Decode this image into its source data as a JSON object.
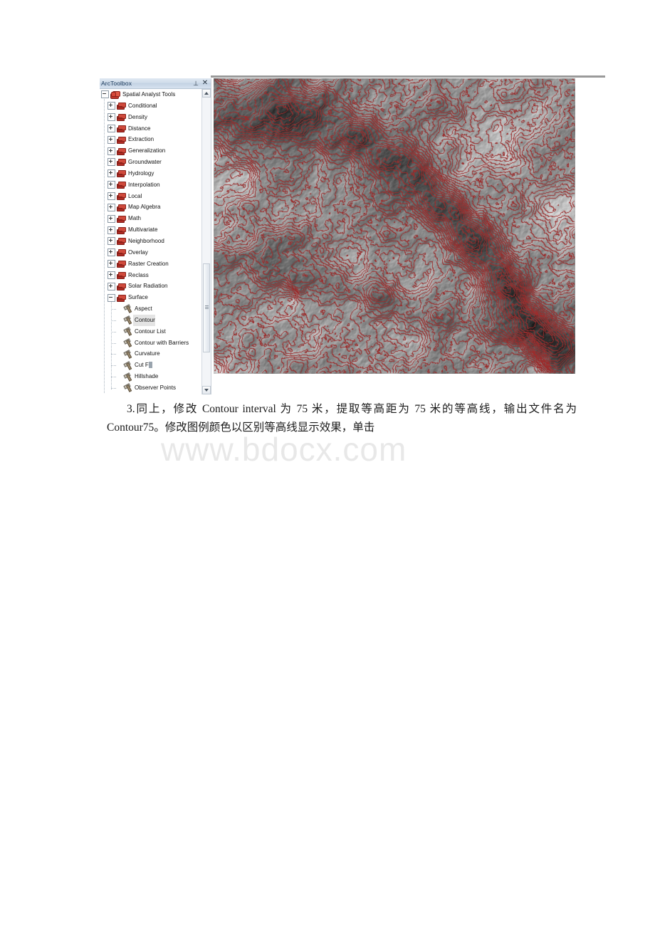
{
  "document": {
    "paragraph_prefix": "3.",
    "paragraph_text": "同上，修改 Contour interval 为 75 米，提取等高距为 75 米的等高线，输出文件名为 Contour75。修改图例颜色以区别等高线显示效果，单击",
    "watermark": "www.bdocx.com"
  },
  "arctoolbox": {
    "title": "ArcToolbox",
    "pin_icon": "pushpin-icon",
    "pin_glyph": "⊥",
    "close_icon": "close-icon",
    "close_glyph": "✕",
    "scrollbar": {
      "up_arrow": "scroll-up-arrow",
      "down_arrow": "scroll-down-arrow",
      "thumb": "scroll-thumb"
    },
    "tree": [
      {
        "label": "Spatial Analyst Tools",
        "level": 0,
        "icon": "toolbox-icon",
        "state": "expanded",
        "selected": false
      },
      {
        "label": "Conditional",
        "level": 1,
        "icon": "toolbox-icon",
        "state": "collapsed",
        "selected": false
      },
      {
        "label": "Density",
        "level": 1,
        "icon": "toolbox-icon",
        "state": "collapsed",
        "selected": false
      },
      {
        "label": "Distance",
        "level": 1,
        "icon": "toolbox-icon",
        "state": "collapsed",
        "selected": false
      },
      {
        "label": "Extraction",
        "level": 1,
        "icon": "toolbox-icon",
        "state": "collapsed",
        "selected": false
      },
      {
        "label": "Generalization",
        "level": 1,
        "icon": "toolbox-icon",
        "state": "collapsed",
        "selected": false
      },
      {
        "label": "Groundwater",
        "level": 1,
        "icon": "toolbox-icon",
        "state": "collapsed",
        "selected": false
      },
      {
        "label": "Hydrology",
        "level": 1,
        "icon": "toolbox-icon",
        "state": "collapsed",
        "selected": false
      },
      {
        "label": "Interpolation",
        "level": 1,
        "icon": "toolbox-icon",
        "state": "collapsed",
        "selected": false
      },
      {
        "label": "Local",
        "level": 1,
        "icon": "toolbox-icon",
        "state": "collapsed",
        "selected": false
      },
      {
        "label": "Map Algebra",
        "level": 1,
        "icon": "toolbox-icon",
        "state": "collapsed",
        "selected": false
      },
      {
        "label": "Math",
        "level": 1,
        "icon": "toolbox-icon",
        "state": "collapsed",
        "selected": false
      },
      {
        "label": "Multivariate",
        "level": 1,
        "icon": "toolbox-icon",
        "state": "collapsed",
        "selected": false
      },
      {
        "label": "Neighborhood",
        "level": 1,
        "icon": "toolbox-icon",
        "state": "collapsed",
        "selected": false
      },
      {
        "label": "Overlay",
        "level": 1,
        "icon": "toolbox-icon",
        "state": "collapsed",
        "selected": false
      },
      {
        "label": "Raster Creation",
        "level": 1,
        "icon": "toolbox-icon",
        "state": "collapsed",
        "selected": false
      },
      {
        "label": "Reclass",
        "level": 1,
        "icon": "toolbox-icon",
        "state": "collapsed",
        "selected": false
      },
      {
        "label": "Solar Radiation",
        "level": 1,
        "icon": "toolbox-icon",
        "state": "collapsed",
        "selected": false
      },
      {
        "label": "Surface",
        "level": 1,
        "icon": "toolbox-icon",
        "state": "expanded",
        "selected": false
      },
      {
        "label": "Aspect",
        "level": 2,
        "icon": "hammer-tool-icon",
        "state": "leaf",
        "selected": false
      },
      {
        "label": "Contour",
        "level": 2,
        "icon": "hammer-tool-icon",
        "state": "leaf",
        "selected": true
      },
      {
        "label": "Contour List",
        "level": 2,
        "icon": "hammer-tool-icon",
        "state": "leaf",
        "selected": false
      },
      {
        "label": "Contour with Barriers",
        "level": 2,
        "icon": "hammer-tool-icon",
        "state": "leaf",
        "selected": false
      },
      {
        "label": "Curvature",
        "level": 2,
        "icon": "hammer-tool-icon",
        "state": "leaf",
        "selected": false
      },
      {
        "label": "Cut Fill",
        "level": 2,
        "icon": "hammer-tool-icon",
        "state": "leaf",
        "selected": false,
        "partial_highlight": 5
      },
      {
        "label": "Hillshade",
        "level": 2,
        "icon": "hammer-tool-icon",
        "state": "leaf",
        "selected": false
      },
      {
        "label": "Observer Points",
        "level": 2,
        "icon": "hammer-tool-icon",
        "state": "leaf",
        "selected": false
      }
    ]
  },
  "map": {
    "name": "contour-over-hillshade-map",
    "description": "Grayscale hillshade raster overlaid with dark red contour lines",
    "contour_color": "#9b2d2d",
    "background_low": "#141414",
    "background_high": "#f2f2f2",
    "contour_interval_label": "75"
  }
}
